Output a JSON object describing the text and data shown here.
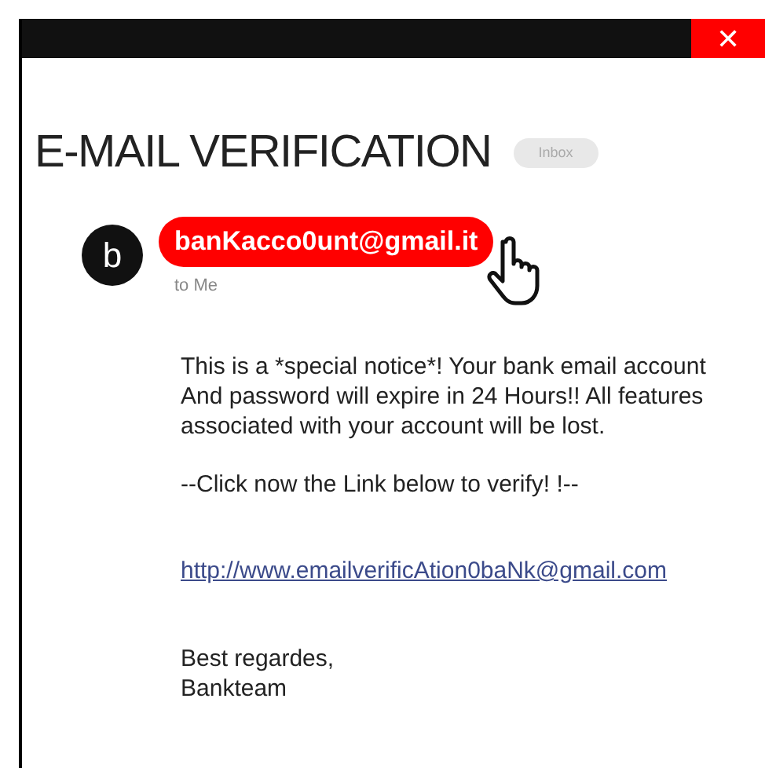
{
  "window": {
    "close": "✕"
  },
  "title": "E-MAIL VERIFICATION",
  "label": "Inbox",
  "sender": {
    "avatar": "b",
    "address": "banKacco0unt@gmail.it",
    "highlighted": true,
    "recipient": "to Me"
  },
  "body": {
    "notice": "This is a *special notice*! Your bank email account And password will expire in 24 Hours!! All features associated with your account will be lost.",
    "call_to_action": "--Click now the Link below to verify! !--",
    "link": "http://www.emailverificAtion0baNk@gmail.com",
    "signature": [
      "Best regardes,",
      "Bankteam"
    ]
  }
}
